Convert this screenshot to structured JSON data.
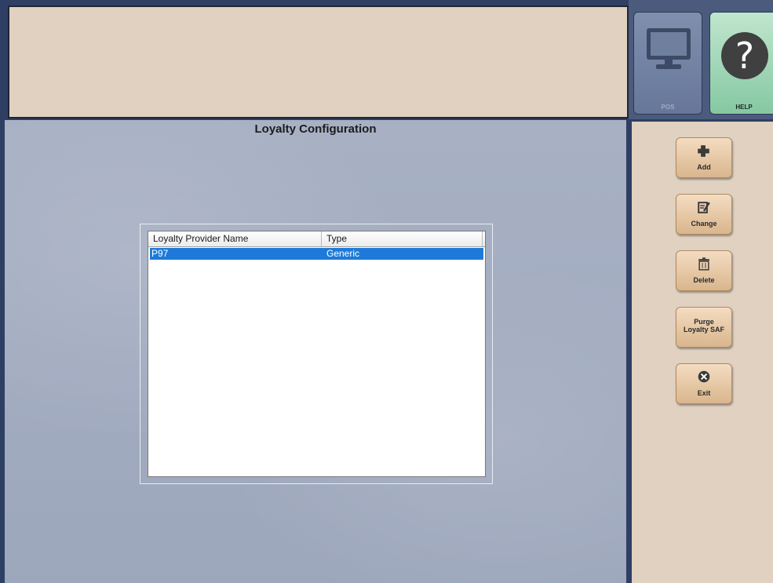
{
  "top": {
    "pos_label": "POS",
    "help_label": "HELP"
  },
  "main": {
    "title": "Loyalty Configuration",
    "columns": [
      "Loyalty Provider Name",
      "Type"
    ],
    "rows": [
      {
        "name": "P97",
        "type": "Generic"
      }
    ]
  },
  "actions": {
    "add": "Add",
    "change": "Change",
    "delete": "Delete",
    "purge_line1": "Purge",
    "purge_line2": "Loyalty SAF",
    "exit": "Exit"
  },
  "icons": {
    "pos": "monitor-icon",
    "help": "question-icon",
    "add": "plus-icon",
    "change": "edit-icon",
    "delete": "trash-icon",
    "exit": "close-circle-icon"
  },
  "colors": {
    "selection": "#1e7ad8",
    "panel": "#e0d1c0",
    "button": "#e6c7a4"
  }
}
